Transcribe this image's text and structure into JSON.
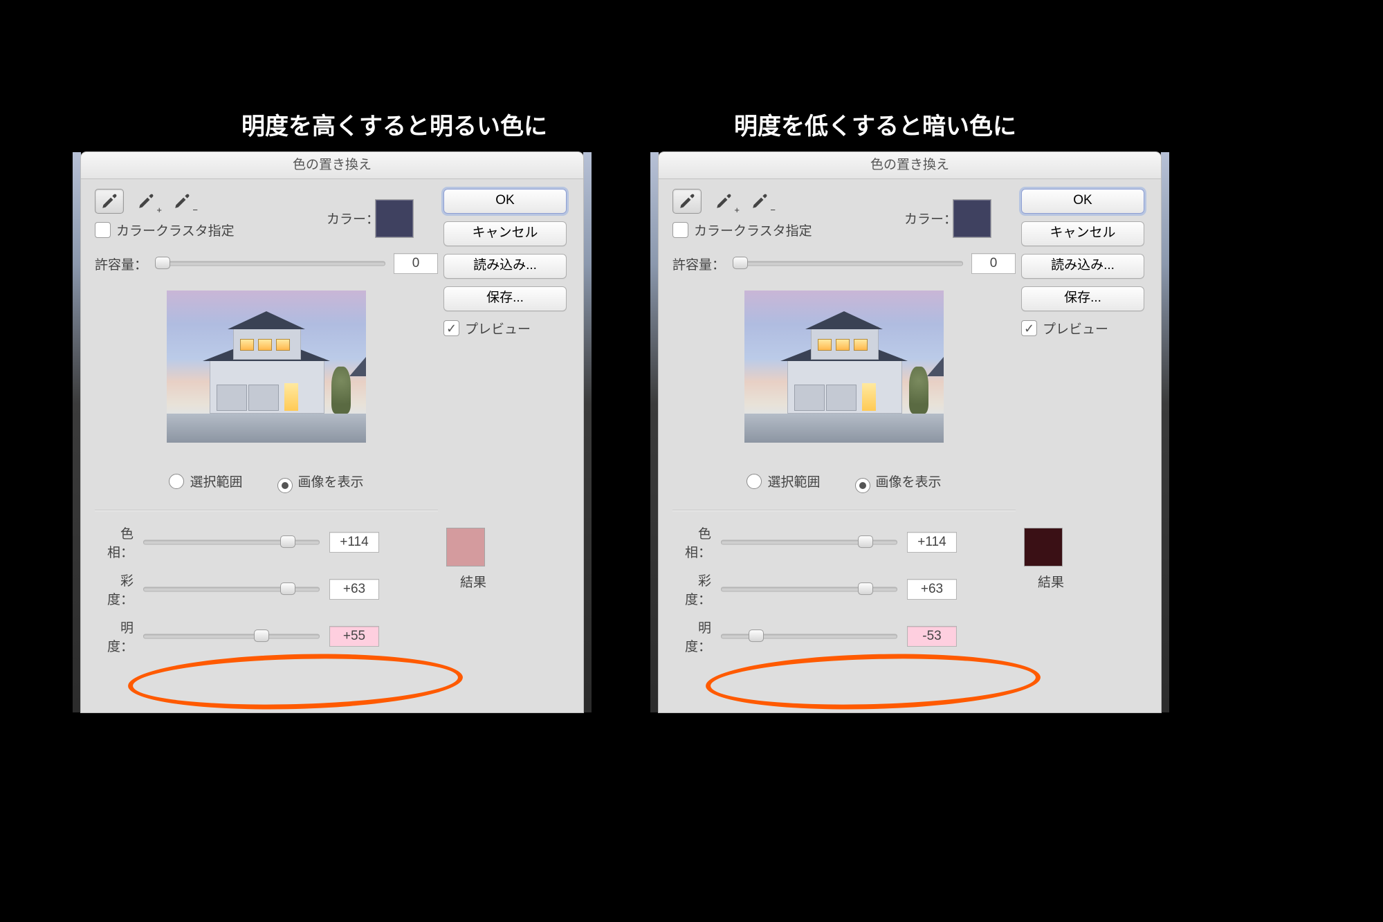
{
  "captions": {
    "left": "明度を高くすると明るい色に",
    "right": "明度を低くすると暗い色に"
  },
  "dialog_title": "色の置き換え",
  "tools": {
    "eyedropper": "eyedropper",
    "eyedropper_plus": "eyedropper-plus",
    "eyedropper_minus": "eyedropper-minus"
  },
  "labels": {
    "color": "カラー：",
    "cluster": "カラークラスタ指定",
    "tolerance": "許容量：",
    "selection_range": "選択範囲",
    "show_image": "画像を表示",
    "hue": "色相：",
    "saturation": "彩度：",
    "lightness": "明度：",
    "result": "結果",
    "preview": "プレビュー"
  },
  "buttons": {
    "ok": "OK",
    "cancel": "キャンセル",
    "load": "読み込み...",
    "save": "保存..."
  },
  "panels": [
    {
      "tolerance": "0",
      "hue": "+114",
      "saturation": "+63",
      "lightness": "+55",
      "lightness_thumb_pct": 67,
      "source_color": "#3f4160",
      "result_color": "#d49b9e"
    },
    {
      "tolerance": "0",
      "hue": "+114",
      "saturation": "+63",
      "lightness": "-53",
      "lightness_thumb_pct": 20,
      "source_color": "#3f4160",
      "result_color": "#3a1015"
    }
  ]
}
